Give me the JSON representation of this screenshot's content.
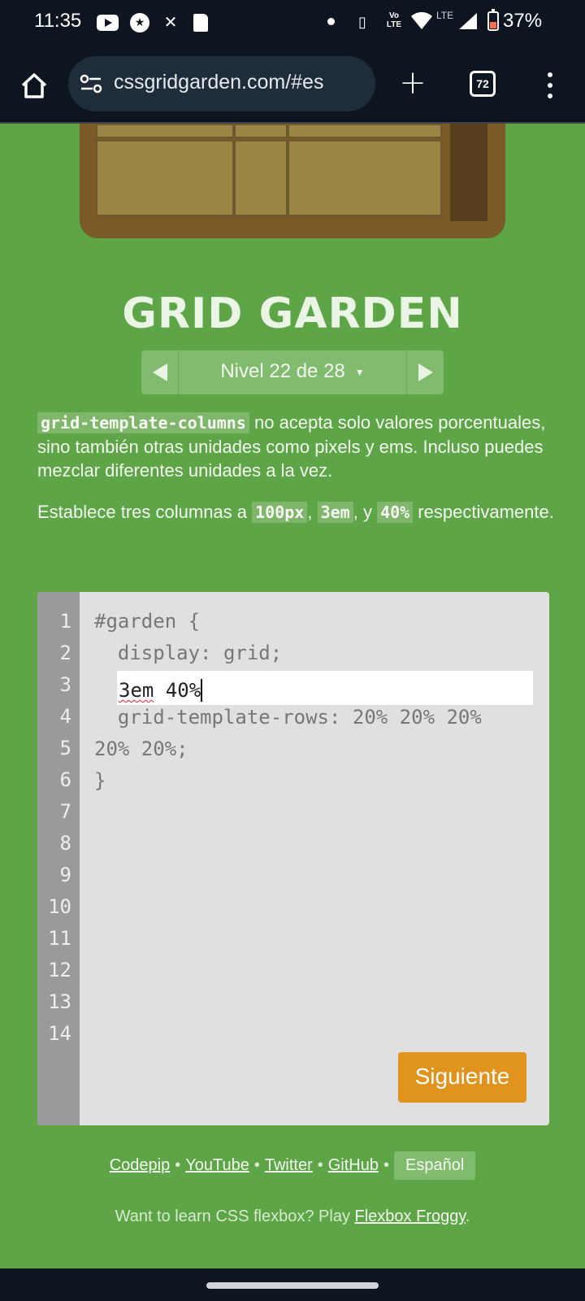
{
  "status_bar": {
    "time": "11:35",
    "network": "LTE",
    "volte": "Vo LTE",
    "battery": "37%",
    "icons": [
      "youtube-icon",
      "circle-star-icon",
      "tools-icon",
      "sd-card-icon",
      "dot-icon",
      "vibrate-icon",
      "volte-icon",
      "wifi-icon",
      "signal-icon",
      "battery-icon"
    ]
  },
  "browser": {
    "url": "cssgridgarden.com/#es",
    "tab_count": "72"
  },
  "game": {
    "title": "GRID GARDEN",
    "level_label": "Nivel 22 de 28",
    "level_caret": "▼"
  },
  "instructions": {
    "p1_code": "grid-template-columns",
    "p1_text": " no acepta solo valores porcentuales, sino también otras unidades como pixels y ems. Incluso puedes mezclar diferentes unidades a la vez.",
    "p2_pre": "Establece tres columnas a ",
    "p2_code1": "100px",
    "p2_sep1": ", ",
    "p2_code2": "3em",
    "p2_sep2": ", y ",
    "p2_code3": "40%",
    "p2_post": " respectivamente."
  },
  "editor": {
    "line_numbers": [
      "1",
      "2",
      "3",
      "4",
      "5",
      "6",
      "7",
      "8",
      "9",
      "10",
      "11",
      "12",
      "13",
      "14"
    ],
    "line1": "#garden {",
    "line2": "  display: grid;",
    "input_first": "3em",
    "input_rest": " 40%",
    "line4": "  grid-template-rows: 20% 20% 20%",
    "line5": "20% 20%;",
    "line6": "}",
    "next_button": "Siguiente"
  },
  "footer": {
    "links": [
      "Codepip",
      "YouTube",
      "Twitter",
      "GitHub"
    ],
    "separator": "•",
    "language": "Español",
    "promo_text": "Want to learn CSS flexbox? Play ",
    "promo_link": "Flexbox Froggy",
    "promo_end": "."
  },
  "colors": {
    "background": "#5ea547",
    "button": "#e0941e",
    "editor": "#e0e0e0"
  }
}
